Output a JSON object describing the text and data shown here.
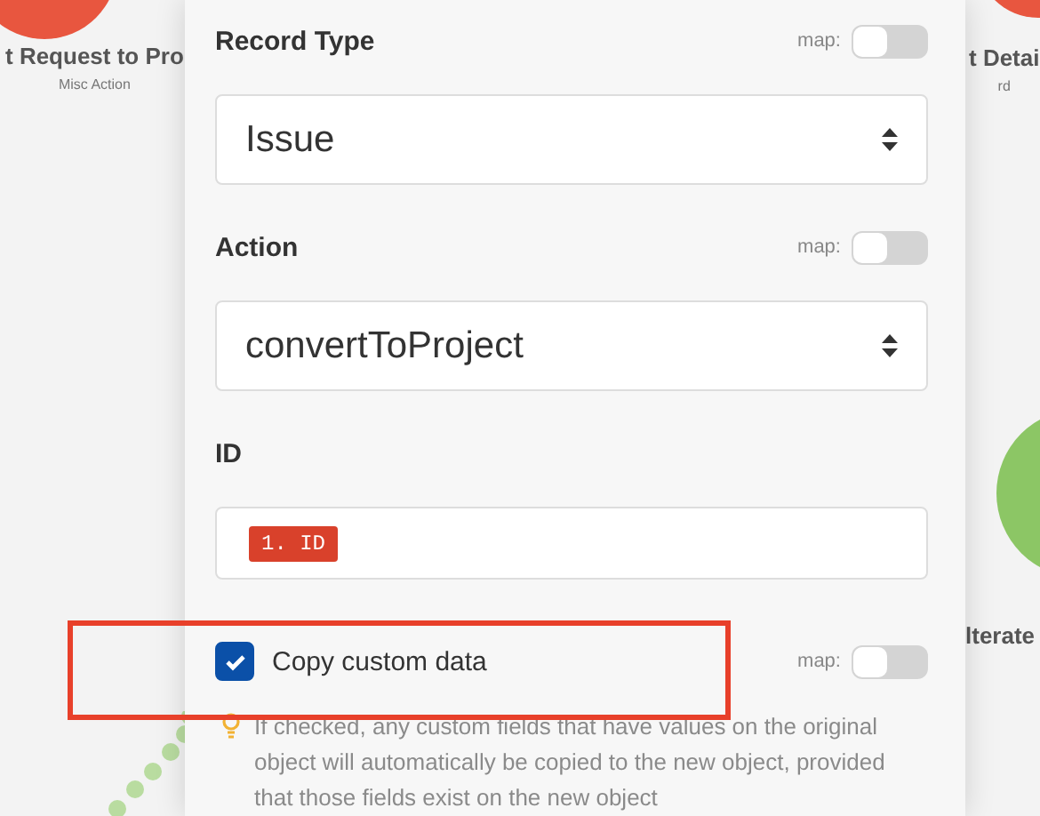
{
  "canvas_nodes": [
    {
      "label": "t Request to Pro",
      "sublabel": "Misc Action",
      "color": "#e8563f"
    },
    {
      "label": "t Detai",
      "sublabel": "rd",
      "color": "#e8563f"
    },
    {
      "label": "lterate",
      "color": "#8cc665"
    }
  ],
  "fields": [
    {
      "kind": "select",
      "label": "Record Type",
      "value": "Issue",
      "map_toggle": {
        "label": "map:",
        "on": false
      }
    },
    {
      "kind": "select",
      "label": "Action",
      "value": "convertToProject",
      "map_toggle": {
        "label": "map:",
        "on": false
      }
    },
    {
      "kind": "token",
      "label": "ID",
      "token": "1. ID"
    },
    {
      "kind": "checkbox",
      "label": "Copy custom data",
      "checked": true,
      "highlighted": true,
      "map_toggle": {
        "label": "map:",
        "on": false
      },
      "hint": "If checked, any custom fields that have values on the original object will automatically be copied to the new object, provided that those fields exist on the new object"
    }
  ]
}
